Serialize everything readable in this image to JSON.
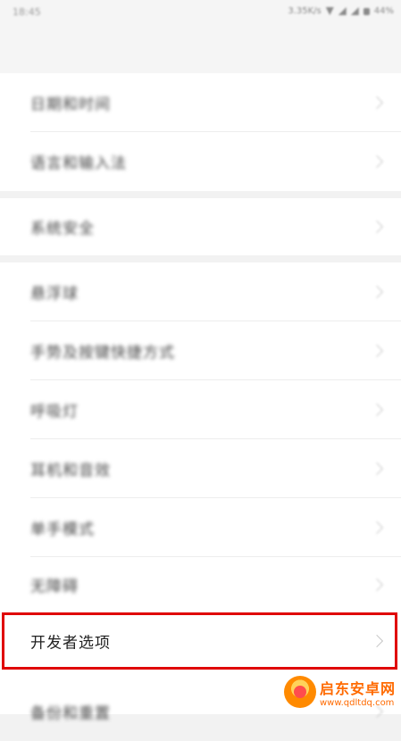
{
  "status_bar": {
    "time": "18:45",
    "speed": "3.35K/s",
    "battery": "44%"
  },
  "settings": {
    "group1": [
      "日期和时间",
      "语言和输入法"
    ],
    "group2": [
      "系统安全"
    ],
    "group3": [
      "悬浮球",
      "手势及按键快捷方式",
      "呼吸灯",
      "耳机和音效",
      "单手模式",
      "无障碍",
      "开发者选项",
      "备份和重置"
    ]
  },
  "watermark": {
    "title": "启东安卓网",
    "url": "www.qdltdq.com"
  },
  "colors": {
    "highlight": "#e00000",
    "watermark": "#ff6a00"
  }
}
